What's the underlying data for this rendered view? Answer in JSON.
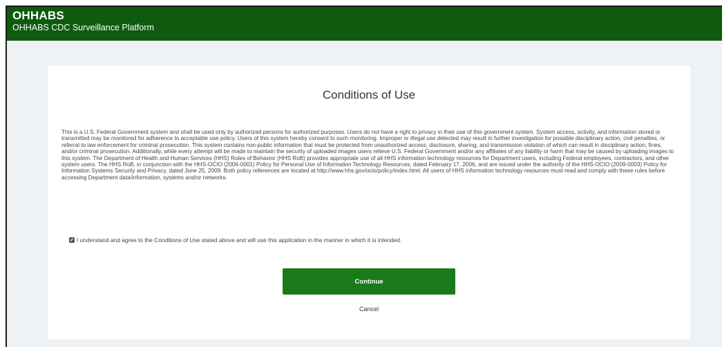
{
  "header": {
    "title": "OHHABS",
    "subtitle": "OHHABS CDC Surveillance Platform",
    "background_color": "#0e5b0e"
  },
  "conditions": {
    "title": "Conditions of Use",
    "body": "This is a U.S. Federal Government system and shall be used only by authorized persons for authorized purposes. Users do not have a right to privacy in their use of this government system. System access, activity, and information stored or transmitted may be monitored for adherence to acceptable use policy. Users of this system hereby consent to such monitoring. Improper or illegal use detected may result in further investigation for possible disciplinary action, civil penalties, or referral to law enforcement for criminal prosecution. This system contains non-public information that must be protected from unauthorized access, disclosure, sharing, and transmission violation of which can result in disciplinary action, fines, and/or criminal prosecution. Additionally, while every attempt will be made to maintain the security of uploaded images users relieve U.S. Federal Government and/or any affiliates of any liability or harm that may be caused by uploading images to this system. The Department of Health and Human Services (HHS) Rules of Behavior (HHS RoB) provides appropriate use of all HHS information technology resources for Department users, including Federal employees, contractors, and other system users. The HHS RoB, in conjunction with the HHS-OCIO (2006-0001) Policy for Personal Use of Information Technology Resources, dated February 17, 2006, and are issued under the authority of the HHS-OCIO (2009-0003) Policy for Information Systems Security and Privacy, dated June 25, 2009. Both policy references are located at http://www.hhs.gov/ocio/policy/index.html. All users of HHS information technology resources must read and comply with these rules before accessing Department data/information, systems and/or networks.",
    "agreement_label": "I understand and agree to the Conditions of Use stated above and will use this application in the manner in which it is intended.",
    "agreement_checked": true
  },
  "actions": {
    "continue_label": "Continue",
    "cancel_label": "Cancel",
    "continue_color": "#1a7a1a"
  }
}
